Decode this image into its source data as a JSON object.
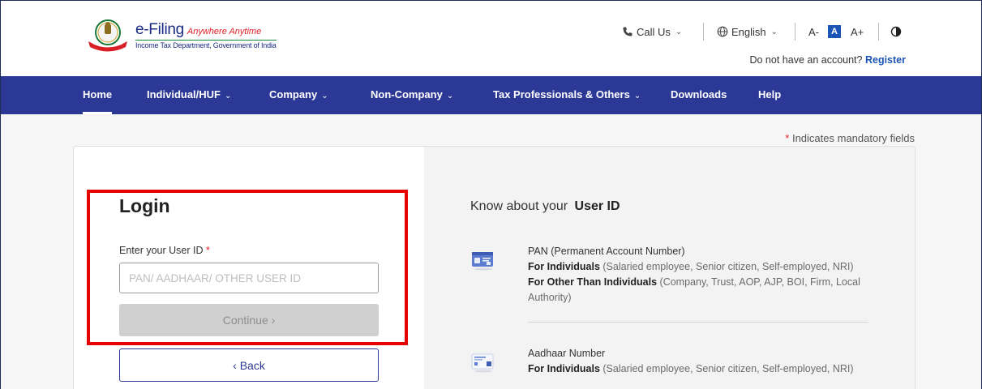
{
  "brand": {
    "title": "e-Filing",
    "tagline": "Anywhere Anytime",
    "subtitle": "Income Tax Department, Government of India"
  },
  "utility": {
    "call_us": "Call Us",
    "language": "English",
    "font_decrease": "A-",
    "font_default": "A",
    "font_increase": "A+",
    "no_account_text": "Do not have an account?",
    "register_label": "Register"
  },
  "nav": {
    "items": [
      {
        "label": "Home",
        "active": true
      },
      {
        "label": "Individual/HUF",
        "has_dropdown": true
      },
      {
        "label": "Company",
        "has_dropdown": true
      },
      {
        "label": "Non-Company",
        "has_dropdown": true
      },
      {
        "label": "Tax Professionals & Others",
        "has_dropdown": true
      },
      {
        "label": "Downloads"
      },
      {
        "label": "Help"
      }
    ]
  },
  "mandatory_note": {
    "star": "*",
    "text": "Indicates mandatory fields"
  },
  "login": {
    "title": "Login",
    "field_label": "Enter your User ID",
    "required_star": "*",
    "placeholder": "PAN/ AADHAAR/ OTHER USER ID",
    "value": "",
    "continue_label": "Continue ›",
    "continue_disabled": true,
    "back_label": "‹ Back"
  },
  "know": {
    "title_prefix": "Know about your",
    "title_bold": "User ID",
    "items": [
      {
        "icon": "pan-card-icon",
        "heading": "PAN (Permanent Account Number)",
        "line1_bold": "For Individuals",
        "line1_rest": "(Salaried employee, Senior citizen, Self-employed, NRI)",
        "line2_bold": "For Other Than Individuals",
        "line2_rest": "(Company, Trust, AOP, AJP, BOI, Firm, Local Authority)"
      },
      {
        "icon": "aadhaar-card-icon",
        "heading": "Aadhaar Number",
        "line1_bold": "For Individuals",
        "line1_rest": "(Salaried employee, Senior citizen, Self-employed, NRI)"
      }
    ]
  },
  "colors": {
    "nav_bg": "#2c3896",
    "brand_blue": "#1b2b85",
    "accent_red": "#e01f26",
    "highlight_red": "#e60000",
    "link_blue": "#1b55b5"
  }
}
